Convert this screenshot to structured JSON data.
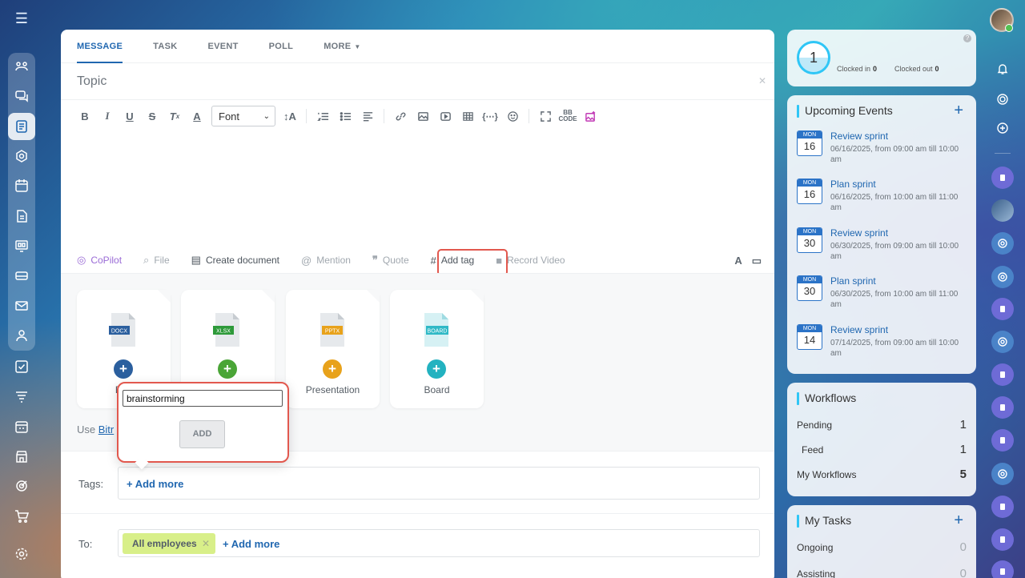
{
  "composer": {
    "tabs": [
      {
        "label": "MESSAGE"
      },
      {
        "label": "TASK"
      },
      {
        "label": "EVENT"
      },
      {
        "label": "POLL"
      },
      {
        "label": "MORE"
      }
    ],
    "topic_placeholder": "Topic",
    "font_select": "Font",
    "actions": {
      "copilot": "CoPilot",
      "file": "File",
      "create_document": "Create document",
      "mention": "Mention",
      "quote": "Quote",
      "add_tag": "Add tag",
      "record_video": "Record Video"
    },
    "docs": [
      {
        "type": "DOCX",
        "label": "Doc",
        "color": "#2b5f9e",
        "plus_color": "#2b5f9e"
      },
      {
        "type": "XLSX",
        "label": "",
        "color": "#2e9a3a",
        "plus_color": "#4aa537"
      },
      {
        "type": "PPTX",
        "label": "Presentation",
        "color": "#e8a21b",
        "plus_color": "#e8a21b"
      },
      {
        "type": "BOARD",
        "label": "Board",
        "color": "#2fb9c6",
        "plus_color": "#23b2c0"
      }
    ],
    "use_prefix": "Use ",
    "use_link": "Bitr",
    "tags_label": "Tags:",
    "tags_add_more": "+ Add more",
    "to_label": "To:",
    "to_chip": "All employees",
    "to_add_more": "+ Add more"
  },
  "tag_popup": {
    "input_value": "brainstorming",
    "add_button": "ADD"
  },
  "timeman": {
    "count": "1",
    "clocked_in_label": "Clocked in",
    "clocked_in_value": "0",
    "clocked_out_label": "Clocked out",
    "clocked_out_value": "0",
    "help": "?"
  },
  "events": {
    "title": "Upcoming Events",
    "items": [
      {
        "month": "MON",
        "day": "16",
        "title": "Review sprint",
        "time": "06/16/2025, from 09:00 am till 10:00 am"
      },
      {
        "month": "MON",
        "day": "16",
        "title": "Plan sprint",
        "time": "06/16/2025, from 10:00 am till 11:00 am"
      },
      {
        "month": "MON",
        "day": "30",
        "title": "Review sprint",
        "time": "06/30/2025, from 09:00 am till 10:00 am"
      },
      {
        "month": "MON",
        "day": "30",
        "title": "Plan sprint",
        "time": "06/30/2025, from 10:00 am till 11:00 am"
      },
      {
        "month": "MON",
        "day": "14",
        "title": "Review sprint",
        "time": "07/14/2025, from 09:00 am till 10:00 am"
      }
    ]
  },
  "workflows": {
    "title": "Workflows",
    "rows": [
      {
        "label": "Pending",
        "value": "1"
      },
      {
        "label": "Feed",
        "value": "1"
      },
      {
        "label": "My Workflows",
        "value": "5"
      }
    ]
  },
  "tasks": {
    "title": "My Tasks",
    "rows": [
      {
        "label": "Ongoing",
        "value": "0"
      },
      {
        "label": "Assisting",
        "value": "0"
      }
    ]
  }
}
